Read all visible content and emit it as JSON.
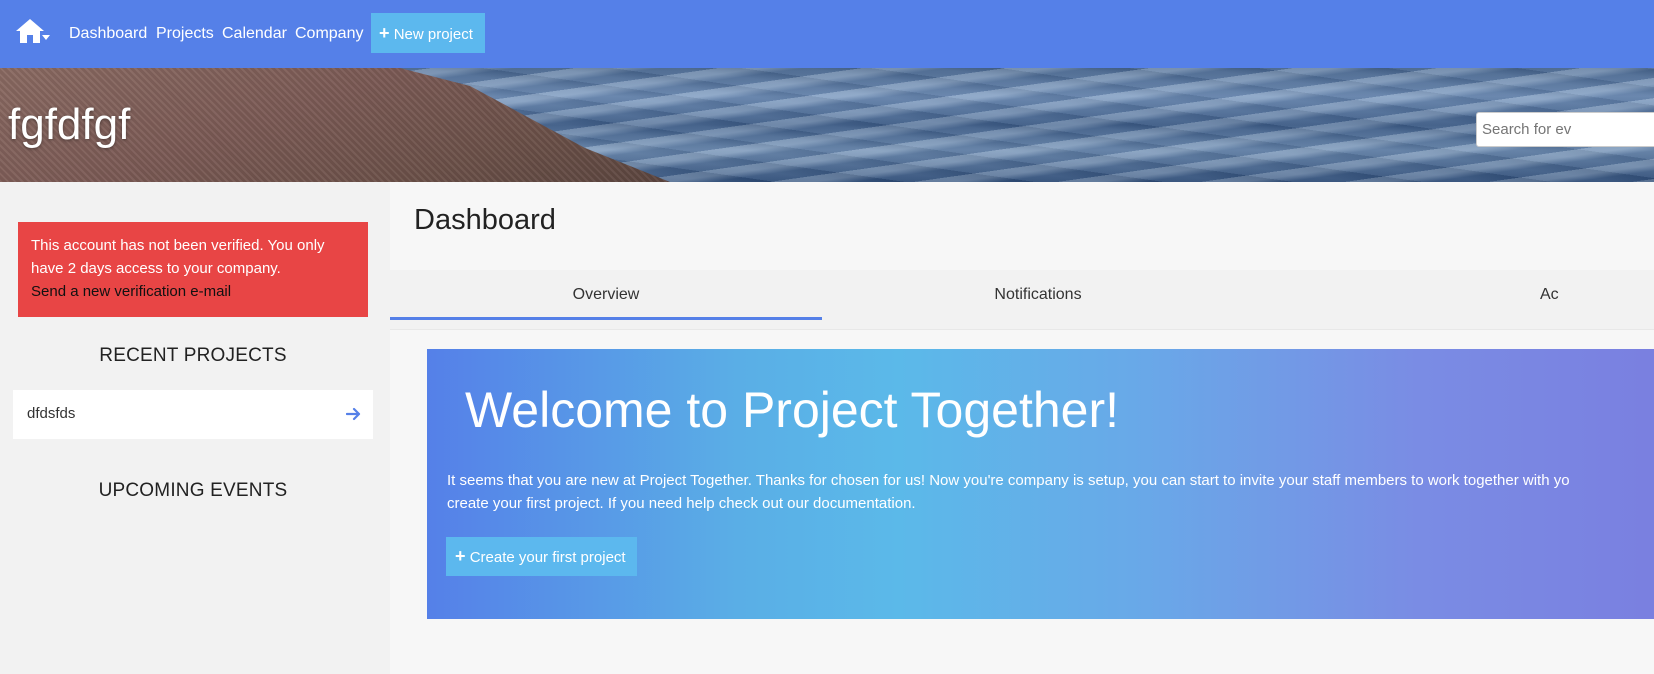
{
  "nav": {
    "links": [
      {
        "label": "Dashboard"
      },
      {
        "label": "Projects"
      },
      {
        "label": "Calendar"
      },
      {
        "label": "Company"
      }
    ],
    "new_project_label": "New project",
    "home_icon": "home-icon"
  },
  "hero": {
    "company_name": "fgfdfgf",
    "search_placeholder": "Search for ev"
  },
  "sidebar": {
    "alert": {
      "message": "This account has not been verified. You only have 2 days access to your company.",
      "link_label": "Send a new verification e-mail",
      "color": "#e84545"
    },
    "recent_projects_heading": "RECENT PROJECTS",
    "recent_projects": [
      {
        "name": "dfdsfds",
        "icon": "arrow-right-icon"
      }
    ],
    "upcoming_events_heading": "UPCOMING EVENTS"
  },
  "main": {
    "page_title": "Dashboard",
    "tabs": [
      {
        "label": "Overview",
        "active": true
      },
      {
        "label": "Notifications",
        "active": false
      },
      {
        "label": "Ac",
        "active": false
      }
    ],
    "welcome": {
      "title": "Welcome to Project Together!",
      "text_line1": "It seems that you are new at Project Together. Thanks for chosen for us! Now you're company is setup, you can start to invite your staff members to work together with yo",
      "text_line2": "create your first project. If you need help check out our documentation.",
      "button_label": "Create your first project"
    }
  },
  "colors": {
    "primary": "#5580e8",
    "accent": "#5cb8ee",
    "danger": "#e84545"
  }
}
